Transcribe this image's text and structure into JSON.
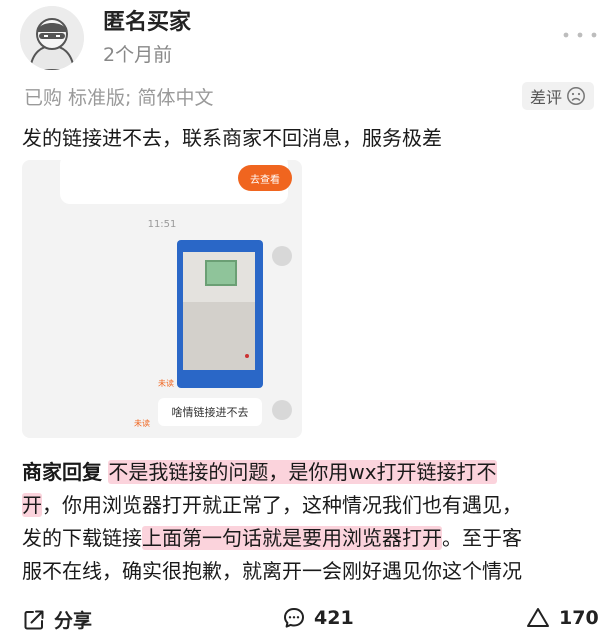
{
  "user": {
    "name": "匿名买家",
    "time": "2个月前"
  },
  "meta": {
    "purchase_info": "已购 标准版; 简体中文",
    "rating_label": "差评"
  },
  "review": {
    "text": "发的链接进不去，联系商家不回消息，服务极差"
  },
  "screenshot": {
    "button_text": "去查看",
    "time": "11:51",
    "message": "啥情链接进不去",
    "unread_label": "未读"
  },
  "reply": {
    "label": "商家回复",
    "lines": [
      {
        "parts": [
          {
            "t": " ",
            "h": false
          },
          {
            "t": "不是我链接的问题，是你用wx打开链接打不",
            "h": true
          }
        ]
      },
      {
        "parts": [
          {
            "t": "开",
            "h": true
          },
          {
            "t": "，你用浏览器打开就正常了，这种情况我们也有遇见，",
            "h": false
          }
        ]
      },
      {
        "parts": [
          {
            "t": "发的下载链接",
            "h": false
          },
          {
            "t": "上面第一句话就是要用浏览器打开",
            "h": true
          },
          {
            "t": "。至于客",
            "h": false
          }
        ]
      },
      {
        "parts": [
          {
            "t": "服不在线，确实很抱歉，就离开一会刚好遇见你这个情况",
            "h": false
          }
        ]
      }
    ]
  },
  "actions": {
    "share_label": "分享",
    "comment_count": "421",
    "like_count": "170"
  },
  "icons": {
    "more": "more-dots-icon",
    "rating": "sad-face-icon",
    "share": "share-icon",
    "comment": "comment-icon",
    "like": "like-icon"
  },
  "colors": {
    "highlight": "#fbd3dc",
    "accent_orange": "#f0651f",
    "muted_text": "#9a9a9a"
  }
}
